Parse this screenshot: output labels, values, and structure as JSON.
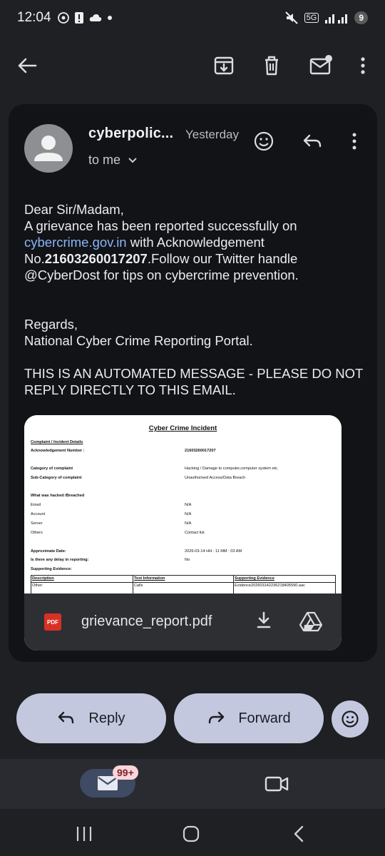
{
  "status_bar": {
    "time": "12:04",
    "network": "5G",
    "battery": "9"
  },
  "toolbar": {
    "back": "back",
    "archive": "archive",
    "delete": "delete",
    "mark_unread": "mark unread",
    "more": "more options"
  },
  "email": {
    "sender": "cyberpolic...",
    "date": "Yesterday",
    "recipient": "to me",
    "body": {
      "greeting": "Dear Sir/Madam,",
      "line1": "A grievance has been reported successfully on",
      "link": "cybercrime.gov.in",
      "line2_after_link": " with Acknowledgement",
      "ack_prefix": "No.",
      "ack_number": "21603260017207",
      "line3_after_ack": ".Follow our Twitter handle",
      "line4": "@CyberDost for tips on cybercrime prevention.",
      "regards": "Regards,",
      "signature": "National Cyber Crime Reporting Portal.",
      "notice": "THIS IS AN AUTOMATED MESSAGE - PLEASE DO NOT REPLY DIRECTLY TO THIS EMAIL."
    }
  },
  "attachment": {
    "filename": "grievance_report.pdf",
    "file_type": "PDF",
    "preview": {
      "title": "Cyber Crime Incident",
      "section": "Complaint / Incident Details",
      "ack_label": "Acknowledgement Number :",
      "ack_value": "21603260017207",
      "category_label": "Category of complaint",
      "category_value": "Hacking / Damage to computer,computer system etc.",
      "subcategory_label": "Sub-Category of complaint",
      "subcategory_value": "Unauthorised Access/Data Breach",
      "hacked_label": "What was hacked /Breached",
      "email_label": "Email",
      "email_value": "N/A",
      "account_label": "Account",
      "account_value": "N/A",
      "server_label": "Server",
      "server_value": "N/A",
      "others_label": "Others",
      "others_value": "Contact list",
      "date_label": "Approximate Date:",
      "date_value": "2026-03-14 HH : 11 MM : 03  AM",
      "delay_label": "Is there any delay in reporting:",
      "delay_value": "No",
      "evidence_label": "Supporting Evidence:",
      "table_headers": [
        "Description",
        "Text Information",
        "Supporting Evidence"
      ],
      "table_row": [
        "Other:",
        "Calls",
        "Evidence202603142236218405590.aac"
      ]
    }
  },
  "actions": {
    "reply": "Reply",
    "forward": "Forward"
  },
  "bottom_nav": {
    "mail_badge": "99+"
  },
  "colors": {
    "background": "#1f2023",
    "card": "#121316",
    "link": "#8ab4f8",
    "button": "#c4c8de"
  }
}
